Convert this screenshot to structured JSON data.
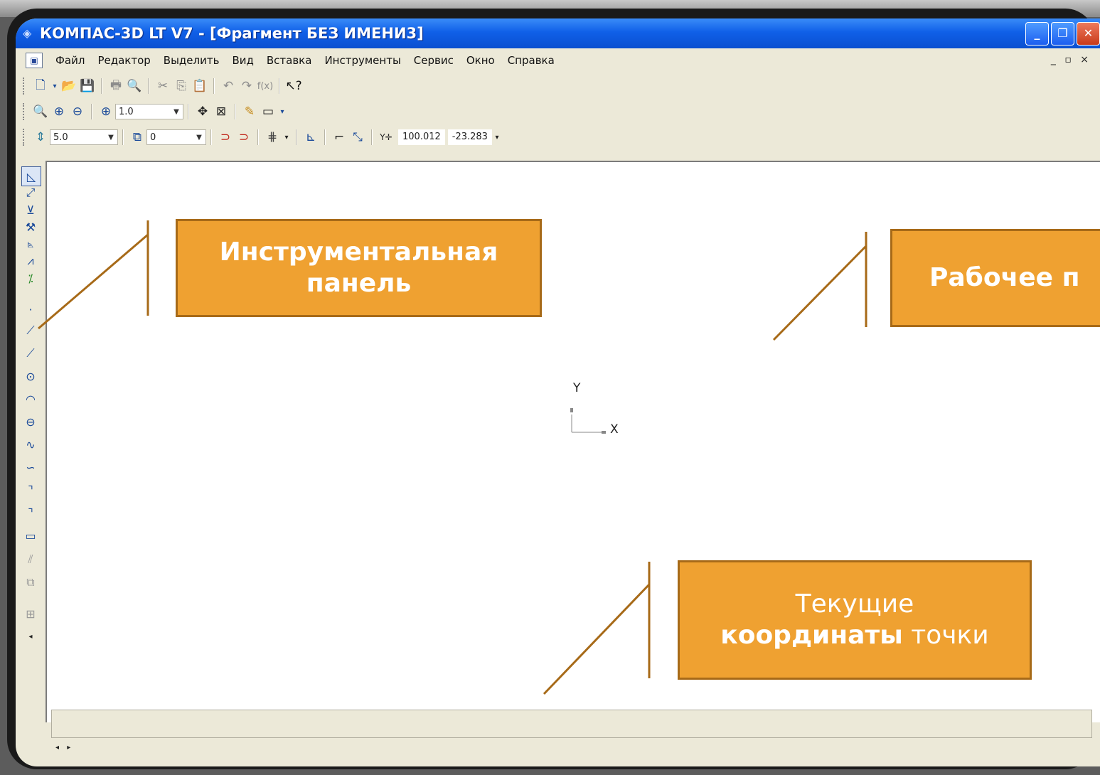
{
  "window": {
    "title": "КОМПАС-3D LT V7 - [Фрагмент БЕЗ ИМЕНИ3]",
    "buttons": {
      "minimize": "_",
      "maximize": "❐",
      "close": "✕"
    }
  },
  "menu": {
    "items": [
      "Файл",
      "Редактор",
      "Выделить",
      "Вид",
      "Вставка",
      "Инструменты",
      "Сервис",
      "Окно",
      "Справка"
    ],
    "mdi_controls": "_ ▫ ×"
  },
  "toolbar_zoom": {
    "scale_value": "1.0"
  },
  "toolbar_current": {
    "step_value": "5.0",
    "layer_value": "0",
    "coord_x": "100.012",
    "coord_y": "-23.283"
  },
  "canvas": {
    "axis_y_label": "Y",
    "axis_x_label": "X"
  },
  "callouts": {
    "toolbar_panel": {
      "line1": "Инструментальная",
      "line2": "панель"
    },
    "work_field": {
      "line1": "Рабочее п"
    },
    "coords": {
      "line1": "Текущие",
      "line2_bold": "координаты",
      "line2_rest": " точки"
    }
  },
  "colors": {
    "callout_fill": "#efa131",
    "callout_border": "#a76a18",
    "leader_line": "#a76a18",
    "titlebar": "#1060e8"
  }
}
